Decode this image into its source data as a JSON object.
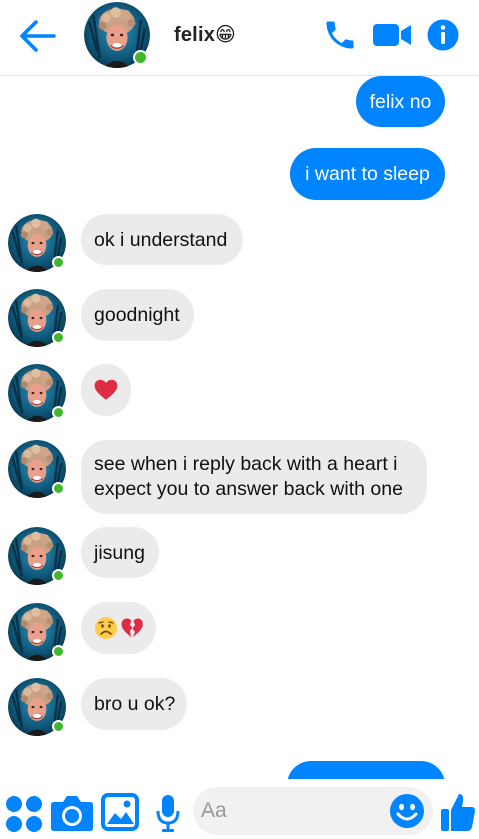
{
  "header": {
    "contact_name": "felix",
    "contact_emoji": "😁",
    "online": true
  },
  "messages": [
    {
      "dir": "out",
      "text": "felix no"
    },
    {
      "dir": "out",
      "text": "i want to sleep"
    },
    {
      "dir": "in",
      "text": "ok i understand"
    },
    {
      "dir": "in",
      "text": "goodnight"
    },
    {
      "dir": "in",
      "emoji": "heart"
    },
    {
      "dir": "in",
      "text": "see when i reply back with a heart i expect you to answer back with one"
    },
    {
      "dir": "in",
      "text": "jisung"
    },
    {
      "dir": "in",
      "emoji": "sad-face + broken-heart"
    },
    {
      "dir": "in",
      "text": "bro u ok?"
    },
    {
      "dir": "out",
      "text": ""
    }
  ],
  "composer": {
    "placeholder": "Aa"
  },
  "icons": {
    "back": "back-arrow-icon",
    "call": "phone-icon",
    "video": "video-camera-icon",
    "info": "info-icon",
    "more": "four-dots-icon",
    "camera": "camera-icon",
    "gallery": "image-icon",
    "mic": "microphone-icon",
    "emoji": "smiley-icon",
    "like": "thumbs-up-icon"
  },
  "colors": {
    "accent": "#0084ff",
    "incoming_bubble": "#ebebeb",
    "online": "#42b72a"
  }
}
